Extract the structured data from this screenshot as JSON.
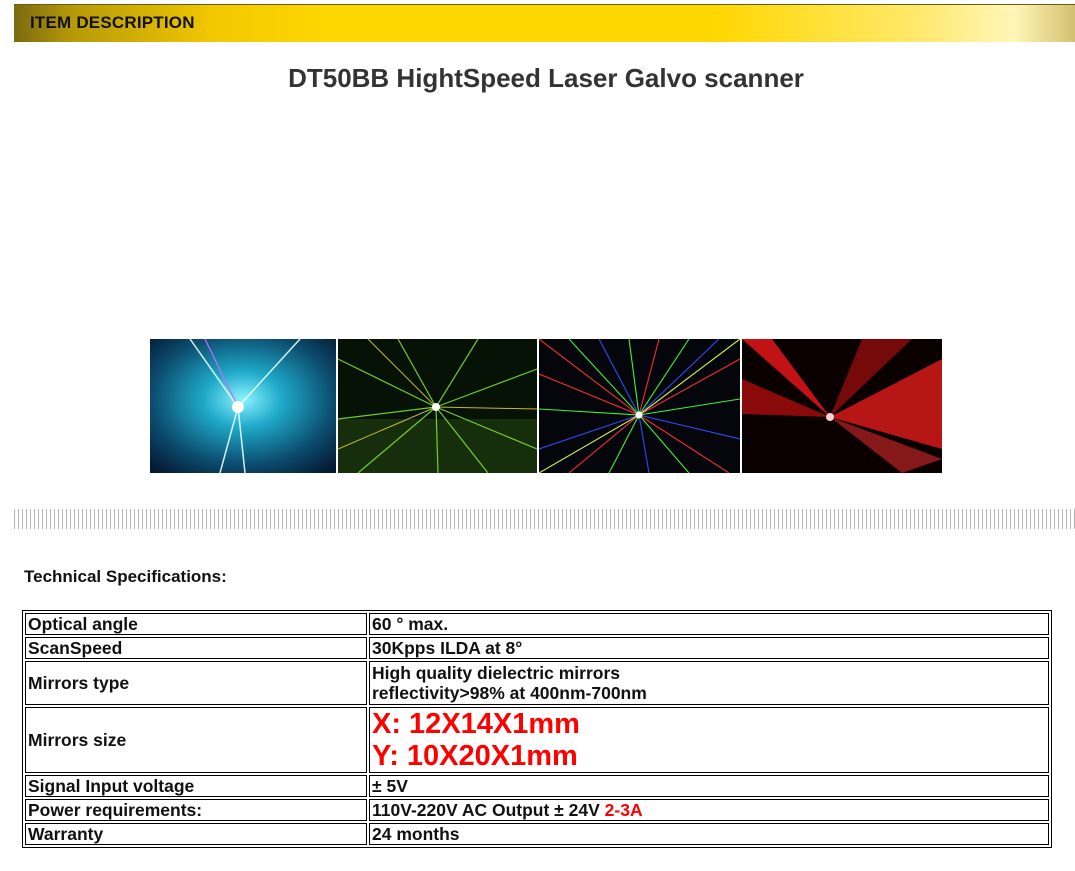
{
  "header": {
    "title": "ITEM DESCRIPTION"
  },
  "product": {
    "title": "DT50BB HightSpeed Laser Galvo scanner"
  },
  "photos": [
    {
      "name": "cyan-laser-photo",
      "accent": "#1ec8e8"
    },
    {
      "name": "green-laser-photo",
      "accent": "#6cd82a"
    },
    {
      "name": "multicolor-laser-photo",
      "accent": "#c8ff60"
    },
    {
      "name": "red-laser-photo",
      "accent": "#ff1a1a"
    }
  ],
  "specs": {
    "heading": "Technical Specifications:",
    "rows": {
      "optical_angle": {
        "label": "Optical angle",
        "value": "60 ° max."
      },
      "scan_speed": {
        "label": "ScanSpeed",
        "value": "30Kpps ILDA at 8°"
      },
      "mirrors_type": {
        "label": "Mirrors type",
        "value_line1": "High quality dielectric mirrors",
        "value_line2": "reflectivity>98% at 400nm-700nm"
      },
      "mirrors_size": {
        "label": "Mirrors size",
        "value_x": "X: 12X14X1mm",
        "value_y": "Y: 10X20X1mm"
      },
      "signal_input": {
        "label": "Signal Input voltage",
        "value": "± 5V"
      },
      "power": {
        "label": "Power requirements:",
        "value_main": "110V-220V AC Output ± 24V ",
        "value_highlight": "2-3A"
      },
      "warranty": {
        "label": "Warranty",
        "value": "24 months"
      }
    }
  },
  "colors": {
    "header_gold": "#ffd700",
    "title_gray": "#333333",
    "highlight_red": "#ff0000"
  }
}
